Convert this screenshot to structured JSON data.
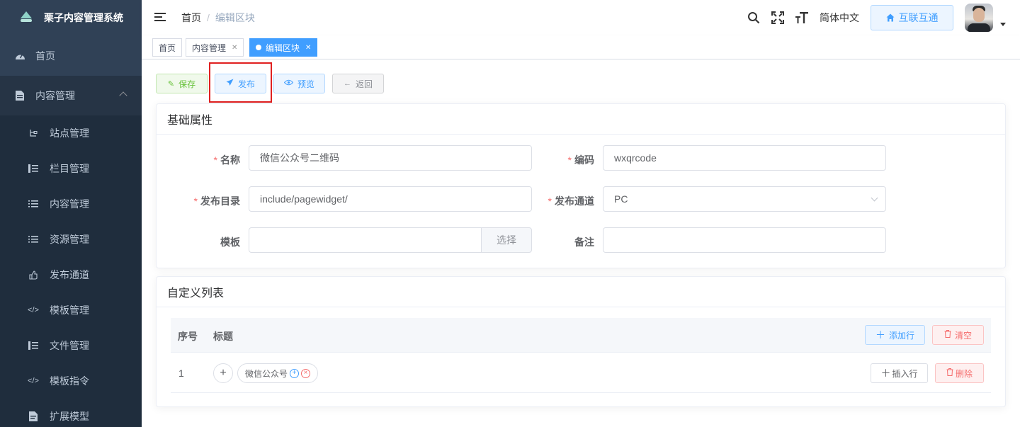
{
  "app": {
    "title": "栗子内容管理系统"
  },
  "sidebar": {
    "items": [
      {
        "label": "首页",
        "icon": "dashboard-icon"
      },
      {
        "label": "内容管理",
        "icon": "document-icon"
      }
    ],
    "subitems": [
      {
        "label": "站点管理",
        "icon": "site-tree-icon"
      },
      {
        "label": "栏目管理",
        "icon": "tree-table-icon"
      },
      {
        "label": "内容管理",
        "icon": "list-icon"
      },
      {
        "label": "资源管理",
        "icon": "list-icon"
      },
      {
        "label": "发布通道",
        "icon": "channel-icon"
      },
      {
        "label": "模板管理",
        "icon": "code-icon"
      },
      {
        "label": "文件管理",
        "icon": "tree-table-icon"
      },
      {
        "label": "模板指令",
        "icon": "code-icon"
      },
      {
        "label": "扩展模型",
        "icon": "model-icon"
      }
    ]
  },
  "header": {
    "breadcrumb": [
      "首页",
      "编辑区块"
    ],
    "language": "简体中文",
    "interconnect": "互联互通"
  },
  "tags": [
    {
      "label": "首页"
    },
    {
      "label": "内容管理"
    },
    {
      "label": "编辑区块"
    }
  ],
  "toolbar": {
    "save": "保存",
    "publish": "发布",
    "preview": "预览",
    "back": "返回"
  },
  "basic": {
    "title": "基础属性",
    "name_label": "名称",
    "name_value": "微信公众号二维码",
    "code_label": "编码",
    "code_value": "wxqrcode",
    "dir_label": "发布目录",
    "dir_value": "include/pagewidget/",
    "channel_label": "发布通道",
    "channel_value": "PC",
    "template_label": "模板",
    "template_value": "",
    "select_label": "选择",
    "remark_label": "备注",
    "remark_value": ""
  },
  "custom": {
    "title": "自定义列表",
    "col_index": "序号",
    "col_title": "标题",
    "add_row": "添加行",
    "clear": "清空",
    "rows": [
      {
        "index": "1",
        "tag": "微信公众号",
        "insert": "插入行",
        "delete": "删除"
      }
    ]
  },
  "colors": {
    "sidebar_bg": "#304156",
    "primary": "#409eff",
    "success": "#67c23a",
    "danger": "#f56c6c",
    "highlight": "#e02020"
  }
}
